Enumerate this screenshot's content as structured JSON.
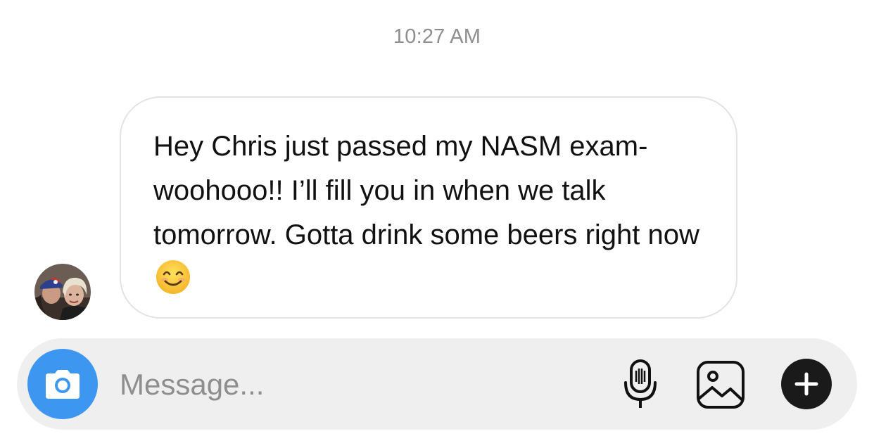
{
  "thread": {
    "timestamp": "10:27 AM",
    "messages": [
      {
        "sender_avatar_icon": "contact-avatar",
        "text": "Hey Chris just passed my NASM exam-woohooo!! I’ll fill you in when we talk tomorrow. Gotta drink some beers right now",
        "trailing_emoji": "smiling-face-emoji"
      }
    ]
  },
  "composer": {
    "placeholder": "Message...",
    "value": "",
    "camera_icon": "camera-icon",
    "mic_icon": "microphone-icon",
    "gallery_icon": "image-gallery-icon",
    "plus_icon": "plus-icon"
  },
  "colors": {
    "accent_blue": "#3d97f0",
    "composer_bg": "#efefef",
    "bubble_border": "#e3e3e3",
    "timestamp_gray": "#8e8e8e"
  }
}
